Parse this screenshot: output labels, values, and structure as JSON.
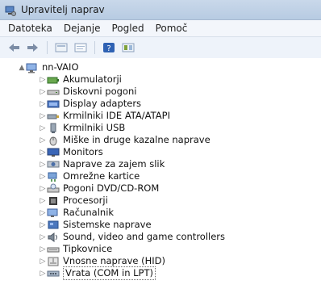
{
  "window": {
    "title": "Upravitelj naprav"
  },
  "menu": [
    {
      "label": "Datoteka"
    },
    {
      "label": "Dejanje"
    },
    {
      "label": "Pogled"
    },
    {
      "label": "Pomoč"
    }
  ],
  "toolbar": {
    "buttons": [
      "back-icon",
      "forward-icon",
      "view-icon",
      "properties-icon",
      "help-icon",
      "show-hidden-icon"
    ]
  },
  "tree": {
    "root": "nn-VAIO",
    "items": [
      {
        "label": "Akumulatorji",
        "icon": "battery-icon"
      },
      {
        "label": "Diskovni pogoni",
        "icon": "disk-drive-icon"
      },
      {
        "label": "Display adapters",
        "icon": "display-adapter-icon"
      },
      {
        "label": "Krmilniki IDE ATA/ATAPI",
        "icon": "ide-controller-icon"
      },
      {
        "label": "Krmilniki USB",
        "icon": "usb-controller-icon"
      },
      {
        "label": "Miške in druge kazalne naprave",
        "icon": "mouse-icon"
      },
      {
        "label": "Monitors",
        "icon": "monitor-icon"
      },
      {
        "label": "Naprave za zajem slik",
        "icon": "imaging-device-icon"
      },
      {
        "label": "Omrežne kartice",
        "icon": "network-adapter-icon"
      },
      {
        "label": "Pogoni DVD/CD-ROM",
        "icon": "dvd-drive-icon"
      },
      {
        "label": "Procesorji",
        "icon": "processor-icon"
      },
      {
        "label": "Računalnik",
        "icon": "computer-icon"
      },
      {
        "label": "Sistemske naprave",
        "icon": "system-device-icon"
      },
      {
        "label": "Sound, video and game controllers",
        "icon": "sound-icon"
      },
      {
        "label": "Tipkovnice",
        "icon": "keyboard-icon"
      },
      {
        "label": "Vnosne naprave (HID)",
        "icon": "hid-icon"
      },
      {
        "label": "Vrata (COM in LPT)",
        "icon": "port-icon"
      }
    ]
  }
}
